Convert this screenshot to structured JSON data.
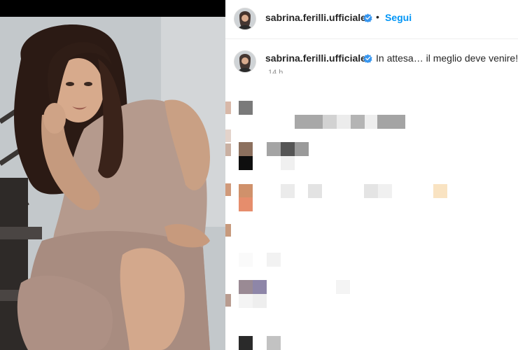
{
  "post": {
    "header": {
      "username": "sabrina.ferilli.ufficiale",
      "separator": "•",
      "follow_label": "Segui"
    },
    "caption": {
      "username": "sabrina.ferilli.ufficiale",
      "text": "In attesa… il meglio deve venire!",
      "time": "14 h"
    },
    "photo_icon": "portrait-photo",
    "verified_icon": "verified-badge-icon",
    "colors": {
      "accent": "#0095f6",
      "text": "#262626",
      "muted": "#8e8e8e"
    }
  }
}
